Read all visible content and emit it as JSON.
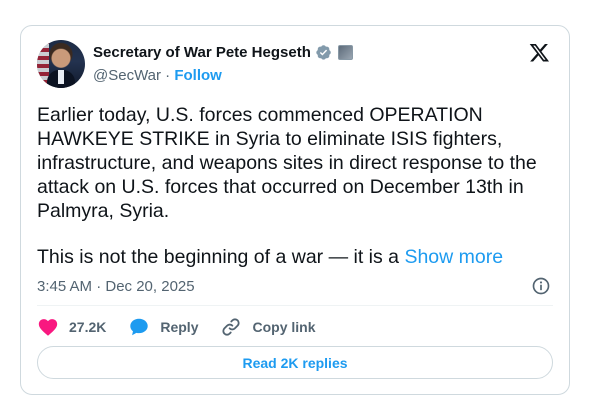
{
  "author": {
    "display_name": "Secretary of War Pete Hegseth",
    "handle": "@SecWar",
    "separator": " · ",
    "follow_label": "Follow"
  },
  "tweet": {
    "text": "Earlier today, U.S. forces commenced OPERATION HAWKEYE STRIKE in Syria to eliminate ISIS fighters, infrastructure, and weapons sites in direct response to the attack on U.S. forces that occurred on December 13th in Palmyra, Syria.",
    "text_truncated": "This is not the beginning of a war — it is a ",
    "show_more_label": "Show more",
    "timestamp": "3:45 AM · Dec 20, 2025"
  },
  "actions": {
    "like_count": "27.2K",
    "reply_label": "Reply",
    "copy_link_label": "Copy link"
  },
  "read_replies_label": "Read 2K replies",
  "colors": {
    "accent": "#1d9bf0",
    "like": "#f91880",
    "text": "#0f1419",
    "secondary_text": "#536471",
    "border": "#cfd9de"
  },
  "icons": [
    "verified-badge-icon",
    "affiliation-badge-icon",
    "x-logo-icon",
    "info-icon",
    "heart-icon",
    "reply-bubble-icon",
    "link-icon"
  ]
}
